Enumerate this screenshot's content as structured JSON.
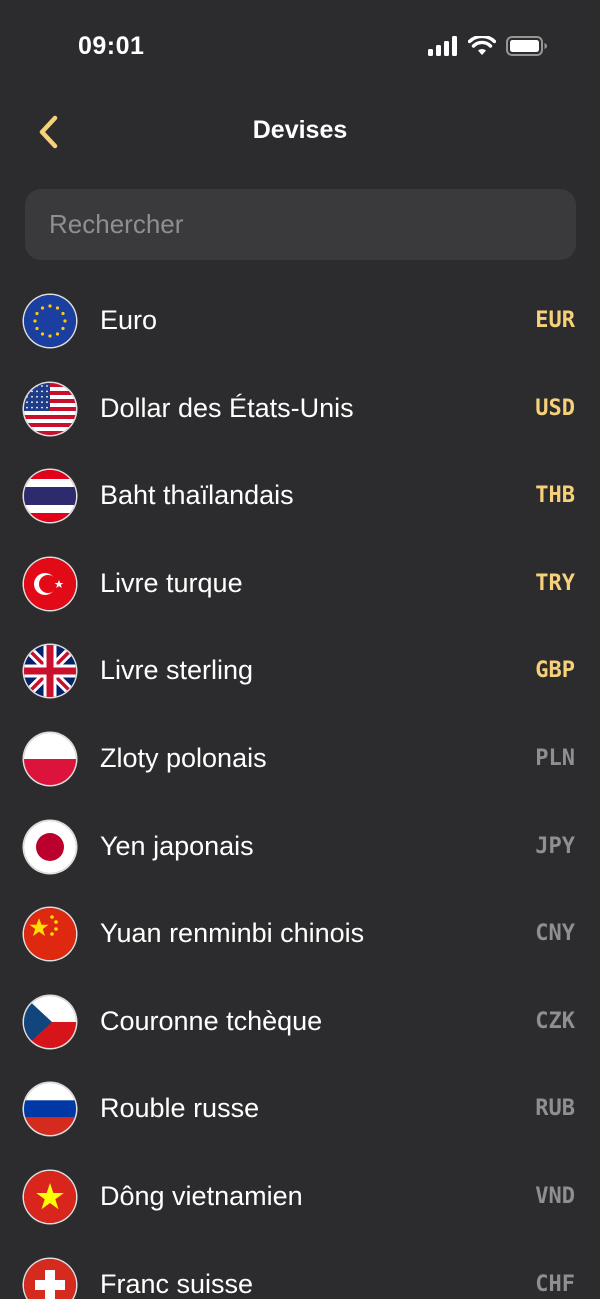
{
  "status_bar": {
    "time": "09:01"
  },
  "nav": {
    "title": "Devises"
  },
  "search": {
    "placeholder": "Rechercher",
    "value": ""
  },
  "colors": {
    "accent": "#f6d17a",
    "background": "#2c2c2e",
    "secondary_text": "#8e8e93"
  },
  "currencies": [
    {
      "name": "Euro",
      "code": "EUR",
      "flag": "eu-flag-icon",
      "highlighted": true
    },
    {
      "name": "Dollar des États-Unis",
      "code": "USD",
      "flag": "us-flag-icon",
      "highlighted": true
    },
    {
      "name": "Baht thaïlandais",
      "code": "THB",
      "flag": "th-flag-icon",
      "highlighted": true
    },
    {
      "name": "Livre turque",
      "code": "TRY",
      "flag": "tr-flag-icon",
      "highlighted": true
    },
    {
      "name": "Livre sterling",
      "code": "GBP",
      "flag": "gb-flag-icon",
      "highlighted": true
    },
    {
      "name": "Zloty polonais",
      "code": "PLN",
      "flag": "pl-flag-icon",
      "highlighted": false
    },
    {
      "name": "Yen japonais",
      "code": "JPY",
      "flag": "jp-flag-icon",
      "highlighted": false
    },
    {
      "name": "Yuan renminbi chinois",
      "code": "CNY",
      "flag": "cn-flag-icon",
      "highlighted": false
    },
    {
      "name": "Couronne tchèque",
      "code": "CZK",
      "flag": "cz-flag-icon",
      "highlighted": false
    },
    {
      "name": "Rouble russe",
      "code": "RUB",
      "flag": "ru-flag-icon",
      "highlighted": false
    },
    {
      "name": "Dông vietnamien",
      "code": "VND",
      "flag": "vn-flag-icon",
      "highlighted": false
    },
    {
      "name": "Franc suisse",
      "code": "CHF",
      "flag": "ch-flag-icon",
      "highlighted": false
    }
  ]
}
